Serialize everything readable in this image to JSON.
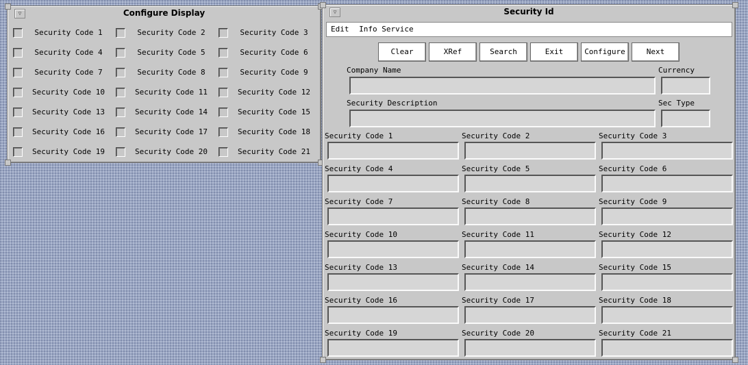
{
  "configure_display": {
    "title": "Configure Display",
    "menu_glyph": "▽",
    "items": [
      {
        "label": "Security Code 1"
      },
      {
        "label": "Security Code 2"
      },
      {
        "label": "Security Code 3"
      },
      {
        "label": "Security Code 4"
      },
      {
        "label": "Security Code 5"
      },
      {
        "label": "Security Code 6"
      },
      {
        "label": "Security Code 7"
      },
      {
        "label": "Security Code 8"
      },
      {
        "label": "Security Code 9"
      },
      {
        "label": "Security Code 10"
      },
      {
        "label": "Security Code 11"
      },
      {
        "label": "Security Code 12"
      },
      {
        "label": "Security Code 13"
      },
      {
        "label": "Security Code 14"
      },
      {
        "label": "Security Code 15"
      },
      {
        "label": "Security Code 16"
      },
      {
        "label": "Security Code 17"
      },
      {
        "label": "Security Code 18"
      },
      {
        "label": "Security Code 19"
      },
      {
        "label": "Security Code 20"
      },
      {
        "label": "Security Code 21"
      }
    ]
  },
  "security_id": {
    "title": "Security Id",
    "menu_glyph": "▽",
    "menu": [
      "Edit",
      "Info Service"
    ],
    "buttons": [
      "Clear",
      "XRef",
      "Search",
      "Exit",
      "Configure",
      "Next"
    ],
    "company_name_label": "Company Name",
    "company_name_value": "",
    "currency_label": "Currency",
    "currency_value": "",
    "description_label": "Security Description",
    "description_value": "",
    "sec_type_label": "Sec Type",
    "sec_type_value": "",
    "codes": [
      {
        "label": "Security Code 1",
        "value": ""
      },
      {
        "label": "Security Code 2",
        "value": ""
      },
      {
        "label": "Security Code 3",
        "value": ""
      },
      {
        "label": "Security Code 4",
        "value": ""
      },
      {
        "label": "Security Code 5",
        "value": ""
      },
      {
        "label": "Security Code 6",
        "value": ""
      },
      {
        "label": "Security Code 7",
        "value": ""
      },
      {
        "label": "Security Code 8",
        "value": ""
      },
      {
        "label": "Security Code 9",
        "value": ""
      },
      {
        "label": "Security Code 10",
        "value": ""
      },
      {
        "label": "Security Code 11",
        "value": ""
      },
      {
        "label": "Security Code 12",
        "value": ""
      },
      {
        "label": "Security Code 13",
        "value": ""
      },
      {
        "label": "Security Code 14",
        "value": ""
      },
      {
        "label": "Security Code 15",
        "value": ""
      },
      {
        "label": "Security Code 16",
        "value": ""
      },
      {
        "label": "Security Code 17",
        "value": ""
      },
      {
        "label": "Security Code 18",
        "value": ""
      },
      {
        "label": "Security Code 19",
        "value": ""
      },
      {
        "label": "Security Code 20",
        "value": ""
      },
      {
        "label": "Security Code 21",
        "value": ""
      }
    ]
  }
}
